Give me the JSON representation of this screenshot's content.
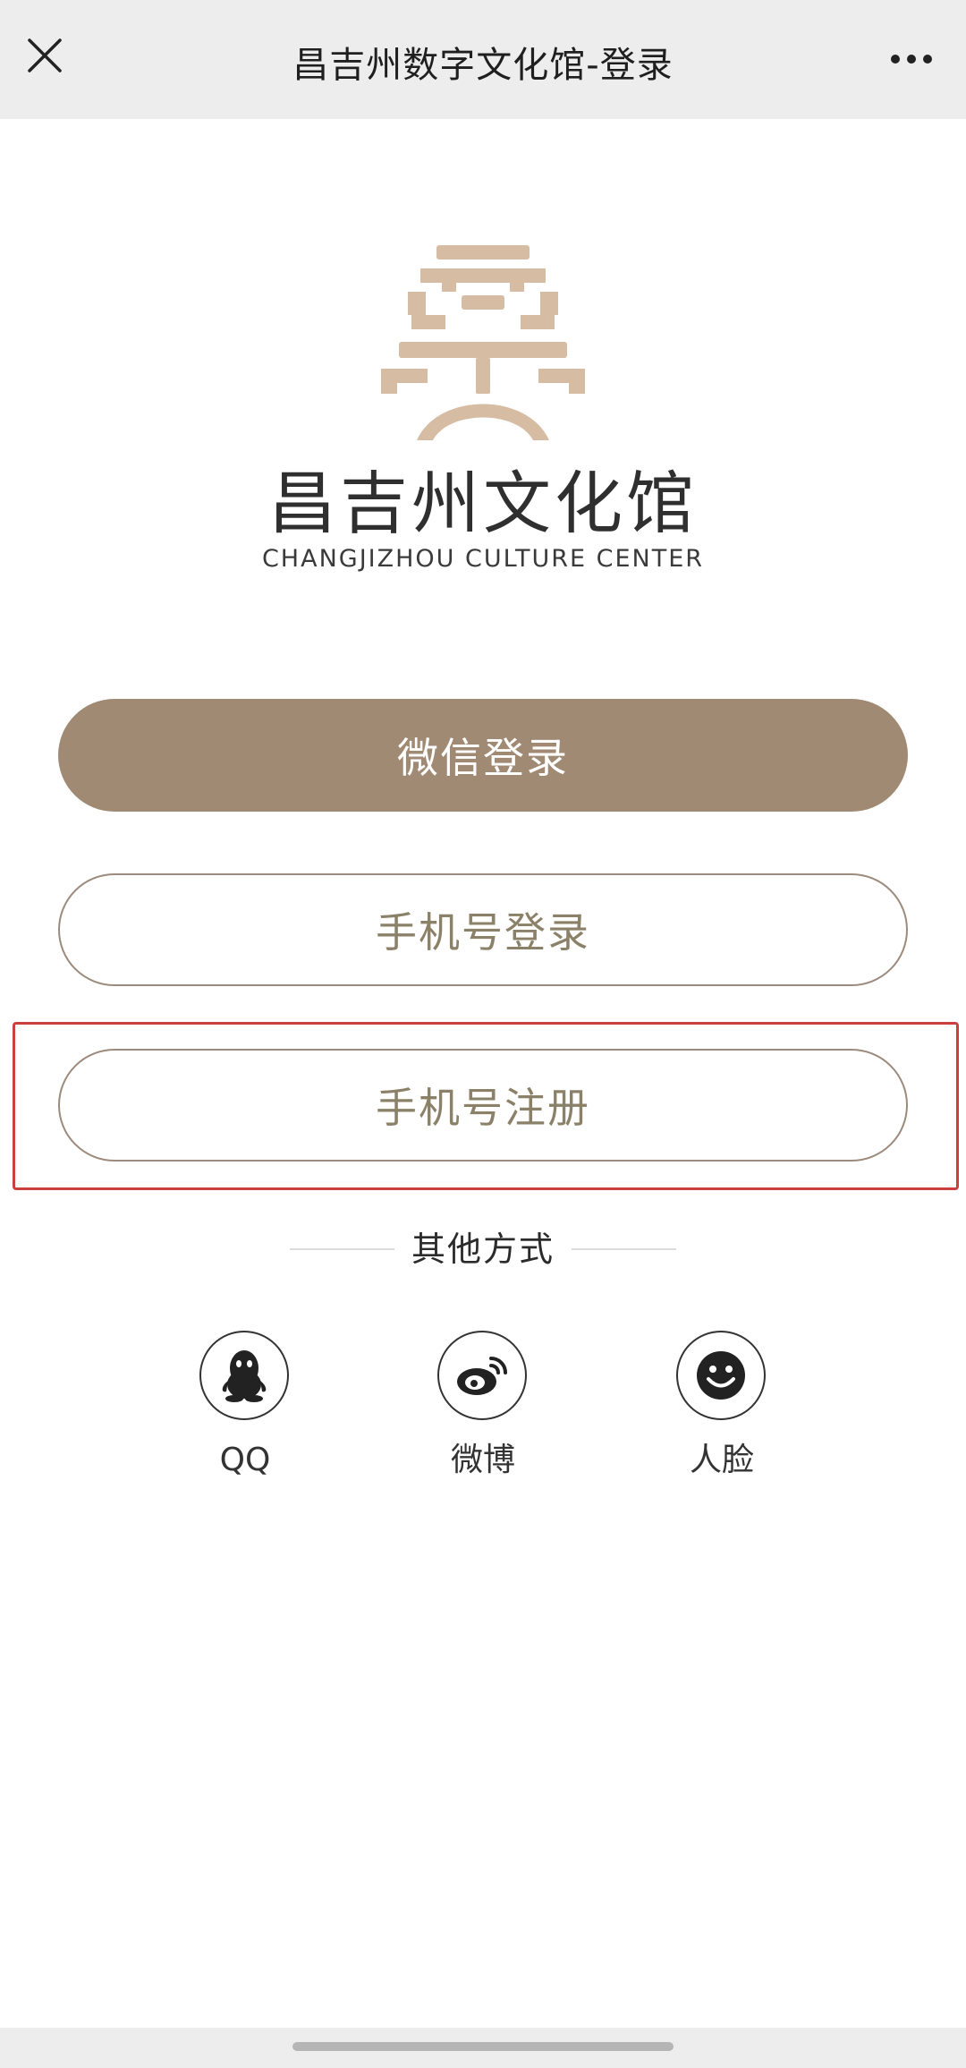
{
  "navbar": {
    "title": "昌吉州数字文化馆-登录",
    "close_icon": "close-icon",
    "more_icon": "more-icon"
  },
  "logo": {
    "name_cn": "昌吉州文化馆",
    "name_en": "CHANGJIZHOU CULTURE CENTER",
    "mark_color": "#d6bca3"
  },
  "buttons": {
    "wechat_login": "微信登录",
    "phone_login": "手机号登录",
    "phone_register": "手机号注册"
  },
  "other_methods": {
    "label": "其他方式",
    "items": [
      {
        "label": "QQ",
        "icon": "qq-penguin-icon"
      },
      {
        "label": "微博",
        "icon": "weibo-icon"
      },
      {
        "label": "人脸",
        "icon": "face-icon"
      }
    ]
  },
  "colors": {
    "primary": "#a18a74",
    "outline_text": "#8b8169",
    "highlight": "#c9403f",
    "navbar_bg": "#ededed"
  }
}
